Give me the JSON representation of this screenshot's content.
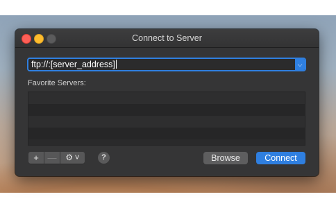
{
  "window": {
    "title": "Connect to Server"
  },
  "server_address": {
    "value": "ftp://:[server_address]"
  },
  "favorites": {
    "label": "Favorite Servers:",
    "rows": [
      "",
      "",
      "",
      ""
    ]
  },
  "toolbar": {
    "add_label": "+",
    "remove_label": "—",
    "gear_label": "⚙ ˅",
    "help_label": "?",
    "browse_label": "Browse",
    "connect_label": "Connect"
  },
  "colors": {
    "accent": "#2f7fe0",
    "window_bg": "#353536",
    "close": "#fd5f57",
    "minimize": "#febc2e"
  },
  "icons": {
    "url_dropdown": "chevron-down-icon",
    "gear": "gear-icon",
    "help": "question-mark-icon"
  }
}
